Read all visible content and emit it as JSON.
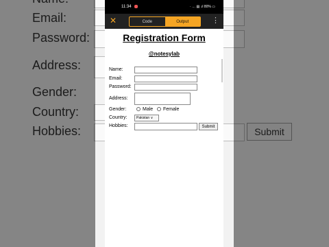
{
  "status_bar": {
    "time": "11:34",
    "indicators": "· … ▤ .ıl 80% ▭"
  },
  "toolbar": {
    "close_icon": "✕",
    "tabs": [
      "Code",
      "Output"
    ],
    "menu_icon": "⋮"
  },
  "form": {
    "title": "Registration Form",
    "handle": "@notesylab",
    "labels": {
      "name": "Name:",
      "email": "Email:",
      "password": "Password:",
      "address": "Address:",
      "gender": "Gender:",
      "country": "Country:",
      "hobbies": "Hobbies:"
    },
    "gender_options": [
      "Male",
      "Female"
    ],
    "country_value": "Pakistan ∨",
    "submit_label": "Submit"
  },
  "background": {
    "labels": [
      "Name:",
      "Email:",
      "Password:",
      "Address:",
      "Gender:",
      "Country:",
      "Hobbies:"
    ],
    "submit_label": "Submit"
  }
}
